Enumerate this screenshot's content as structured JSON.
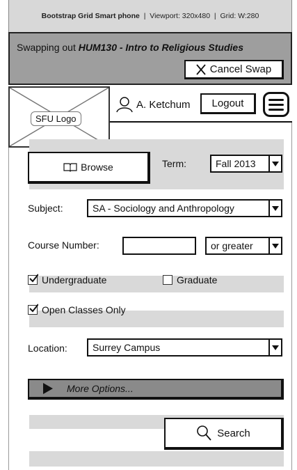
{
  "caption": {
    "title": "Bootstrap Grid Smart phone",
    "sep1": "|",
    "viewport": "Viewport: 320x480",
    "sep2": "|",
    "grid": "Grid: W:280"
  },
  "swap": {
    "prefix": "Swapping out",
    "course": "HUM130 - Intro to Religious Studies",
    "cancel_label": "Cancel Swap"
  },
  "nav": {
    "logo_label": "SFU Logo",
    "user_name": "A. Ketchum",
    "logout_label": "Logout"
  },
  "form": {
    "browse_label": "Browse",
    "term_label": "Term:",
    "term_value": "Fall 2013",
    "subject_label": "Subject:",
    "subject_value": "SA - Sociology and Anthropology",
    "course_number_label": "Course Number:",
    "course_number_value": "",
    "course_number_modifier": "or greater",
    "undergraduate_label": "Undergraduate",
    "undergraduate_checked": true,
    "graduate_label": "Graduate",
    "graduate_checked": false,
    "open_classes_label": "Open Classes Only",
    "open_classes_checked": true,
    "location_label": "Location:",
    "location_value": "Surrey Campus",
    "more_options_label": "More Options...",
    "search_label": "Search"
  }
}
